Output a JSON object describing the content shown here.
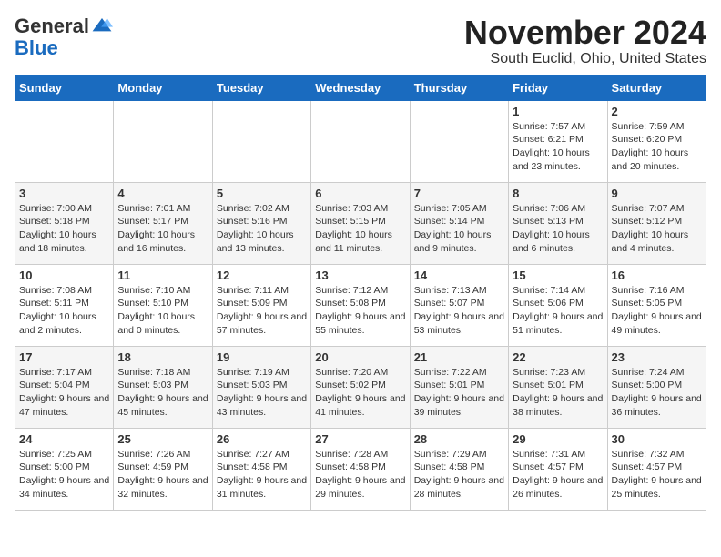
{
  "logo": {
    "general": "General",
    "blue": "Blue"
  },
  "title": "November 2024",
  "subtitle": "South Euclid, Ohio, United States",
  "weekdays": [
    "Sunday",
    "Monday",
    "Tuesday",
    "Wednesday",
    "Thursday",
    "Friday",
    "Saturday"
  ],
  "weeks": [
    [
      {
        "day": "",
        "info": ""
      },
      {
        "day": "",
        "info": ""
      },
      {
        "day": "",
        "info": ""
      },
      {
        "day": "",
        "info": ""
      },
      {
        "day": "",
        "info": ""
      },
      {
        "day": "1",
        "info": "Sunrise: 7:57 AM\nSunset: 6:21 PM\nDaylight: 10 hours and 23 minutes."
      },
      {
        "day": "2",
        "info": "Sunrise: 7:59 AM\nSunset: 6:20 PM\nDaylight: 10 hours and 20 minutes."
      }
    ],
    [
      {
        "day": "3",
        "info": "Sunrise: 7:00 AM\nSunset: 5:18 PM\nDaylight: 10 hours and 18 minutes."
      },
      {
        "day": "4",
        "info": "Sunrise: 7:01 AM\nSunset: 5:17 PM\nDaylight: 10 hours and 16 minutes."
      },
      {
        "day": "5",
        "info": "Sunrise: 7:02 AM\nSunset: 5:16 PM\nDaylight: 10 hours and 13 minutes."
      },
      {
        "day": "6",
        "info": "Sunrise: 7:03 AM\nSunset: 5:15 PM\nDaylight: 10 hours and 11 minutes."
      },
      {
        "day": "7",
        "info": "Sunrise: 7:05 AM\nSunset: 5:14 PM\nDaylight: 10 hours and 9 minutes."
      },
      {
        "day": "8",
        "info": "Sunrise: 7:06 AM\nSunset: 5:13 PM\nDaylight: 10 hours and 6 minutes."
      },
      {
        "day": "9",
        "info": "Sunrise: 7:07 AM\nSunset: 5:12 PM\nDaylight: 10 hours and 4 minutes."
      }
    ],
    [
      {
        "day": "10",
        "info": "Sunrise: 7:08 AM\nSunset: 5:11 PM\nDaylight: 10 hours and 2 minutes."
      },
      {
        "day": "11",
        "info": "Sunrise: 7:10 AM\nSunset: 5:10 PM\nDaylight: 10 hours and 0 minutes."
      },
      {
        "day": "12",
        "info": "Sunrise: 7:11 AM\nSunset: 5:09 PM\nDaylight: 9 hours and 57 minutes."
      },
      {
        "day": "13",
        "info": "Sunrise: 7:12 AM\nSunset: 5:08 PM\nDaylight: 9 hours and 55 minutes."
      },
      {
        "day": "14",
        "info": "Sunrise: 7:13 AM\nSunset: 5:07 PM\nDaylight: 9 hours and 53 minutes."
      },
      {
        "day": "15",
        "info": "Sunrise: 7:14 AM\nSunset: 5:06 PM\nDaylight: 9 hours and 51 minutes."
      },
      {
        "day": "16",
        "info": "Sunrise: 7:16 AM\nSunset: 5:05 PM\nDaylight: 9 hours and 49 minutes."
      }
    ],
    [
      {
        "day": "17",
        "info": "Sunrise: 7:17 AM\nSunset: 5:04 PM\nDaylight: 9 hours and 47 minutes."
      },
      {
        "day": "18",
        "info": "Sunrise: 7:18 AM\nSunset: 5:03 PM\nDaylight: 9 hours and 45 minutes."
      },
      {
        "day": "19",
        "info": "Sunrise: 7:19 AM\nSunset: 5:03 PM\nDaylight: 9 hours and 43 minutes."
      },
      {
        "day": "20",
        "info": "Sunrise: 7:20 AM\nSunset: 5:02 PM\nDaylight: 9 hours and 41 minutes."
      },
      {
        "day": "21",
        "info": "Sunrise: 7:22 AM\nSunset: 5:01 PM\nDaylight: 9 hours and 39 minutes."
      },
      {
        "day": "22",
        "info": "Sunrise: 7:23 AM\nSunset: 5:01 PM\nDaylight: 9 hours and 38 minutes."
      },
      {
        "day": "23",
        "info": "Sunrise: 7:24 AM\nSunset: 5:00 PM\nDaylight: 9 hours and 36 minutes."
      }
    ],
    [
      {
        "day": "24",
        "info": "Sunrise: 7:25 AM\nSunset: 5:00 PM\nDaylight: 9 hours and 34 minutes."
      },
      {
        "day": "25",
        "info": "Sunrise: 7:26 AM\nSunset: 4:59 PM\nDaylight: 9 hours and 32 minutes."
      },
      {
        "day": "26",
        "info": "Sunrise: 7:27 AM\nSunset: 4:58 PM\nDaylight: 9 hours and 31 minutes."
      },
      {
        "day": "27",
        "info": "Sunrise: 7:28 AM\nSunset: 4:58 PM\nDaylight: 9 hours and 29 minutes."
      },
      {
        "day": "28",
        "info": "Sunrise: 7:29 AM\nSunset: 4:58 PM\nDaylight: 9 hours and 28 minutes."
      },
      {
        "day": "29",
        "info": "Sunrise: 7:31 AM\nSunset: 4:57 PM\nDaylight: 9 hours and 26 minutes."
      },
      {
        "day": "30",
        "info": "Sunrise: 7:32 AM\nSunset: 4:57 PM\nDaylight: 9 hours and 25 minutes."
      }
    ]
  ]
}
